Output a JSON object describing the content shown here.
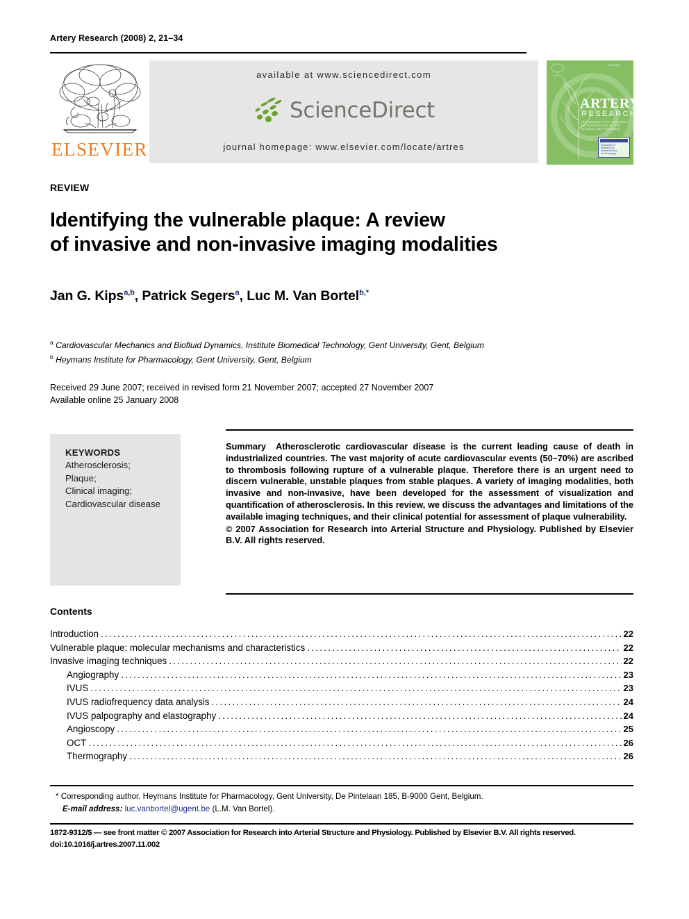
{
  "running_head": "Artery Research (2008) 2, 21–34",
  "masthead": {
    "publisher_name": "ELSEVIER",
    "available_at": "available at www.sciencedirect.com",
    "sciencedirect_wordmark": "ScienceDirect",
    "journal_homepage": "journal homepage: www.elsevier.com/locate/artres",
    "cover": {
      "title": "ARTERY",
      "subtitle": "RESEARCH",
      "tagline": "The Journal of the Association for Research into Arterial Structure and Physiology",
      "imprint": "ELSEVIER",
      "badge_lines": "Association for\nResearch into\nArterial Structure\nand Physiology"
    },
    "brand_orange": "#ef7d1a",
    "brand_green": "#6aa329",
    "cover_green": "#86bf63",
    "band_gray": "#e6e6e6"
  },
  "article": {
    "doc_type": "REVIEW",
    "title_line1": "Identifying the vulnerable plaque: A review",
    "title_line2": "of invasive and non-invasive imaging modalities",
    "authors": [
      {
        "name": "Jan G. Kips",
        "marks": "a,b",
        "sep": ", "
      },
      {
        "name": "Patrick Segers",
        "marks": "a",
        "sep": ", "
      },
      {
        "name": "Luc M. Van Bortel",
        "marks": "b,*",
        "sep": ""
      }
    ],
    "affiliations": [
      {
        "mark": "a",
        "text": "Cardiovascular Mechanics and Biofluid Dynamics, Institute Biomedical Technology, Gent University, Gent, Belgium"
      },
      {
        "mark": "b",
        "text": "Heymans Institute for Pharmacology, Gent University, Gent, Belgium"
      }
    ],
    "dates_line1": "Received 29 June 2007; received in revised form 21 November 2007; accepted 27 November 2007",
    "dates_line2": "Available online 25 January 2008"
  },
  "keywords": {
    "heading": "KEYWORDS",
    "items": [
      "Atherosclerosis;",
      "Plaque;",
      "Clinical imaging;",
      "Cardiovascular disease"
    ]
  },
  "abstract": {
    "label": "Summary",
    "text": "Atherosclerotic cardiovascular disease is the current leading cause of death in industrialized countries. The vast majority of acute cardiovascular events (50–70%) are ascribed to thrombosis following rupture of a vulnerable plaque. Therefore there is an urgent need to discern vulnerable, unstable plaques from stable plaques. A variety of imaging modalities, both invasive and non-invasive, have been developed for the assessment of visualization and quantification of atherosclerosis. In this review, we discuss the advantages and limitations of the available imaging techniques, and their clinical potential for assessment of plaque vulnerability.",
    "copyright": "© 2007 Association for Research into Arterial Structure and Physiology. Published by Elsevier B.V. All rights reserved."
  },
  "contents": {
    "heading": "Contents",
    "entries": [
      {
        "label": "Introduction",
        "page": "22",
        "indent": false
      },
      {
        "label": "Vulnerable plaque: molecular mechanisms and characteristics",
        "page": "22",
        "indent": false
      },
      {
        "label": "Invasive imaging techniques",
        "page": "22",
        "indent": false
      },
      {
        "label": "Angiography",
        "page": "23",
        "indent": true
      },
      {
        "label": "IVUS",
        "page": "23",
        "indent": true
      },
      {
        "label": "IVUS radiofrequency data analysis",
        "page": "24",
        "indent": true
      },
      {
        "label": "IVUS palpography and elastography",
        "page": "24",
        "indent": true
      },
      {
        "label": "Angioscopy",
        "page": "25",
        "indent": true
      },
      {
        "label": "OCT",
        "page": "26",
        "indent": true
      },
      {
        "label": "Thermography",
        "page": "26",
        "indent": true
      }
    ]
  },
  "footnote": {
    "corresponding": "* Corresponding author. Heymans Institute for Pharmacology, Gent University, De Pintelaan 185, B-9000 Gent, Belgium.",
    "email_label": "E-mail address:",
    "email": "luc.vanbortel@ugent.be",
    "email_suffix": "(L.M. Van Bortel).",
    "email_color": "#1b2a8c"
  },
  "imprint": {
    "line1": "1872-9312/$ — see front matter © 2007 Association for Research into Arterial Structure and Physiology. Published by Elsevier B.V. All rights reserved.",
    "line2": "doi:10.1016/j.artres.2007.11.002"
  }
}
